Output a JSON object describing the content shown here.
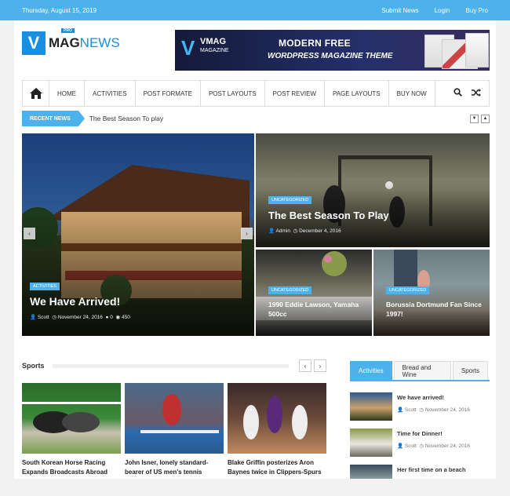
{
  "topbar": {
    "date": "Thursday, August 15, 2019",
    "links": [
      "Submit News",
      "Login",
      "Buy Pro"
    ]
  },
  "logo": {
    "v": "V",
    "mag": "MAG",
    "news": "NEWS",
    "pro": "PRO"
  },
  "banner": {
    "brand_v": "V",
    "brand": "VMAG",
    "brand_sub": "MAGAZINE",
    "line1": "MODERN FREE",
    "line2": "WORDPRESS MAGAZINE THEME"
  },
  "nav": {
    "items": [
      "HOME",
      "ACTIVITIES",
      "POST FORMATE",
      "POST LAYOUTS",
      "POST REVIEW",
      "PAGE LAYOUTS",
      "BUY NOW"
    ]
  },
  "ticker": {
    "label": "RECENT NEWS",
    "text": "The Best Season To play"
  },
  "slider": {
    "main": {
      "category": "ACTIVITIES",
      "title": "We Have Arrived!",
      "author": "Scott",
      "date": "November 24, 2016",
      "comments": "0",
      "views": "450"
    },
    "top_right": {
      "category": "UNCATEGORIZED",
      "title": "The Best Season To Play",
      "author": "Admin",
      "date": "December 4, 2016"
    },
    "bottom_left": {
      "category": "UNCATEGORIZED",
      "title": "1990 Eddie Lawson, Yamaha 500cc"
    },
    "bottom_right": {
      "category": "UNCATEGORIZED",
      "title": "Borussia Dortmund Fan Since 1997!"
    }
  },
  "sports": {
    "title": "Sports",
    "cards": [
      {
        "title": "South Korean Horse Racing Expands Broadcasts Abroad"
      },
      {
        "title": "John Isner, lonely standard-bearer of US men's tennis"
      },
      {
        "title": "Blake Griffin posterizes Aron Baynes twice in Clippers-Spurs"
      }
    ]
  },
  "sidebar": {
    "tabs": [
      "Activities",
      "Bread and Wine",
      "Sports"
    ],
    "items": [
      {
        "title": "We have arrived!",
        "author": "Scott",
        "date": "November 24, 2016"
      },
      {
        "title": "Time for Dinner!",
        "author": "Scott",
        "date": "November 24, 2016"
      },
      {
        "title": "Her first time on a beach"
      }
    ]
  },
  "colors": {
    "accent": "#4db2ec",
    "logo_blue": "#1a8ee0"
  }
}
